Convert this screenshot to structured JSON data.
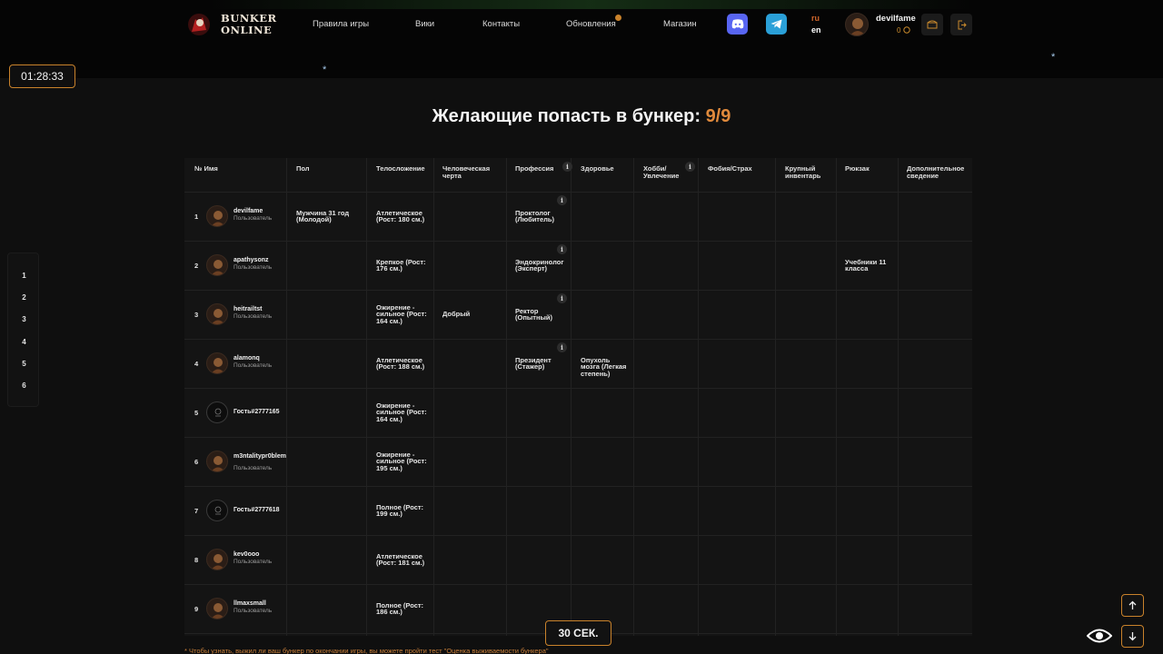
{
  "header": {
    "logo_text": [
      "BUNKER",
      "ONLINE"
    ],
    "nav": [
      {
        "label": "Правила игры",
        "name": "nav-rules"
      },
      {
        "label": "Вики",
        "name": "nav-wiki"
      },
      {
        "label": "Контакты",
        "name": "nav-contacts"
      },
      {
        "label": "Обновления",
        "name": "nav-updates"
      },
      {
        "label": "Магазин",
        "name": "nav-shop"
      }
    ],
    "social_icons": [
      "discord-icon",
      "telegram-icon"
    ],
    "languages": {
      "ru": "ru",
      "en": "en"
    },
    "user": {
      "name": "devilfame",
      "coins": "0"
    },
    "right_icons": [
      "chest-icon",
      "logout-icon"
    ]
  },
  "timer": "01:28:33",
  "title": {
    "text": "Желающие попасть в бункер:",
    "count": "9/9"
  },
  "pager": [
    "1",
    "2",
    "3",
    "4",
    "5",
    "6"
  ],
  "table": {
    "columns": [
      "№ Имя",
      "Пол",
      "Телосложение",
      "Человеческая черта",
      "Профессия",
      "Здоровье",
      "Хобби/ Увлечение",
      "Фобия/Страх",
      "Крупный инвентарь",
      "Рюкзак",
      "Дополнительное сведение"
    ],
    "rows": [
      {
        "num": "1",
        "name": "devilfame",
        "role": "Пользователь",
        "guest": false,
        "sex": "Мужчина 31 год (Молодой)",
        "body": "Атлетическое (Рост: 180 см.)",
        "trait": "",
        "profession": "Проктолог (Любитель)",
        "health": "",
        "hobby": "",
        "phobia": "",
        "inventory": "",
        "backpack": "",
        "extra": ""
      },
      {
        "num": "2",
        "name": "apathysonz",
        "role": "Пользователь",
        "guest": false,
        "sex": "",
        "body": "Крепкое (Рост: 176 см.)",
        "trait": "",
        "profession": "Эндокринолог (Эксперт)",
        "health": "",
        "hobby": "",
        "phobia": "",
        "inventory": "",
        "backpack": "Учебники 11 класса",
        "extra": ""
      },
      {
        "num": "3",
        "name": "heitrailtst",
        "role": "Пользователь",
        "guest": false,
        "sex": "",
        "body": "Ожирение - сильное (Рост: 164 см.)",
        "trait": "Добрый",
        "profession": "Ректор (Опытный)",
        "health": "",
        "hobby": "",
        "phobia": "",
        "inventory": "",
        "backpack": "",
        "extra": ""
      },
      {
        "num": "4",
        "name": "alamonq",
        "role": "Пользователь",
        "guest": false,
        "sex": "",
        "body": "Атлетическое (Рост: 188 см.)",
        "trait": "",
        "profession": "Президент (Стажер)",
        "health": "Опухоль мозга (Легкая степень)",
        "hobby": "",
        "phobia": "",
        "inventory": "",
        "backpack": "",
        "extra": ""
      },
      {
        "num": "5",
        "name": "Гость#2777165",
        "role": "",
        "guest": true,
        "sex": "",
        "body": "Ожирение - сильное (Рост: 164 см.)",
        "trait": "",
        "profession": "",
        "health": "",
        "hobby": "",
        "phobia": "",
        "inventory": "",
        "backpack": "",
        "extra": ""
      },
      {
        "num": "6",
        "name": "m3ntalitypr0blem",
        "role": "Пользователь",
        "guest": false,
        "sex": "",
        "body": "Ожирение - сильное (Рост: 195 см.)",
        "trait": "",
        "profession": "",
        "health": "",
        "hobby": "",
        "phobia": "",
        "inventory": "",
        "backpack": "",
        "extra": ""
      },
      {
        "num": "7",
        "name": "Гость#2777618",
        "role": "",
        "guest": true,
        "sex": "",
        "body": "Полное (Рост: 199 см.)",
        "trait": "",
        "profession": "",
        "health": "",
        "hobby": "",
        "phobia": "",
        "inventory": "",
        "backpack": "",
        "extra": ""
      },
      {
        "num": "8",
        "name": "kev0ooo",
        "role": "Пользователь",
        "guest": false,
        "sex": "",
        "body": "Атлетическое (Рост: 181 см.)",
        "trait": "",
        "profession": "",
        "health": "",
        "hobby": "",
        "phobia": "",
        "inventory": "",
        "backpack": "",
        "extra": ""
      },
      {
        "num": "9",
        "name": "llmaxsmall",
        "role": "Пользователь",
        "guest": false,
        "sex": "",
        "body": "Полное (Рост: 186 см.)",
        "trait": "",
        "profession": "",
        "health": "",
        "hobby": "",
        "phobia": "",
        "inventory": "",
        "backpack": "",
        "extra": ""
      }
    ]
  },
  "seconds_button": "30 СЕК.",
  "footnote": "* Чтобы узнать, выжил ли ваш бункер по окончании игры, вы можете пройти тест \"Оценка выживаемости бункера\"",
  "colors": {
    "accent": "#c9822b",
    "title_count": "#e08a3c",
    "discord": "#5865f2",
    "telegram": "#2aa0d8"
  }
}
